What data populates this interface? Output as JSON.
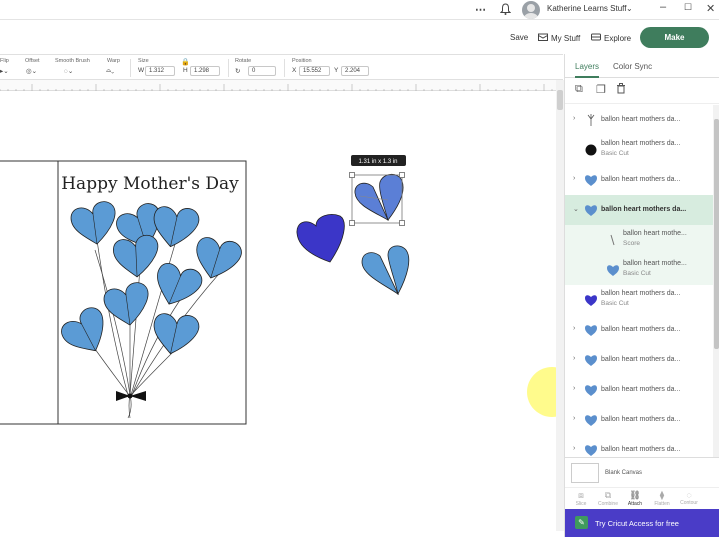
{
  "topbar": {
    "user_name": "Katherine Learns Stuff",
    "icons": [
      "more-icon",
      "bell-icon",
      "avatar",
      "chevron-down-icon",
      "minimize-icon",
      "maximize-icon",
      "close-icon"
    ]
  },
  "actions": {
    "save": "Save",
    "my_stuff": "My Stuff",
    "explore": "Explore",
    "make": "Make",
    "accent": "#3f7d5d"
  },
  "toolbar": {
    "flip_label": "Flip",
    "offset_label": "Offset",
    "smooth_label": "Smooth Brush",
    "warp_label": "Warp",
    "size_label": "Size",
    "w_prefix": "W",
    "w_value": "1.312",
    "h_prefix": "H",
    "h_value": "1.298",
    "rotate_label": "Rotate",
    "rotate_value": "0",
    "position_label": "Position",
    "x_prefix": "X",
    "x_value": "15.552",
    "y_prefix": "Y",
    "y_value": "2.204"
  },
  "canvas": {
    "card_title": "Happy Mother's Day",
    "size_tooltip": "1.31 in x 1.3 in"
  },
  "panel": {
    "tab_layers": "Layers",
    "tab_color_sync": "Color Sync",
    "layers": [
      {
        "name": "ballon heart mothers da...",
        "sub": "",
        "kind": "group",
        "thumb": "balloon"
      },
      {
        "name": "ballon heart mothers da...",
        "sub": "Basic Cut",
        "kind": "item",
        "thumb": "dot"
      },
      {
        "name": "ballon heart mothers da...",
        "sub": "",
        "kind": "group",
        "thumb": "heart-blue"
      },
      {
        "name": "ballon heart mothers da...",
        "sub": "",
        "kind": "selected",
        "thumb": "heart-blue"
      },
      {
        "name": "ballon heart mothe...",
        "sub": "Score",
        "kind": "child",
        "thumb": "line"
      },
      {
        "name": "ballon heart mothe...",
        "sub": "Basic Cut",
        "kind": "child",
        "thumb": "heart-blue"
      },
      {
        "name": "ballon heart mothers da...",
        "sub": "Basic Cut",
        "kind": "item",
        "thumb": "heart-purple"
      },
      {
        "name": "ballon heart mothers da...",
        "sub": "",
        "kind": "group",
        "thumb": "heart-blue"
      },
      {
        "name": "ballon heart mothers da...",
        "sub": "",
        "kind": "group",
        "thumb": "heart-blue"
      },
      {
        "name": "ballon heart mothers da...",
        "sub": "",
        "kind": "group",
        "thumb": "heart-blue"
      },
      {
        "name": "ballon heart mothers da...",
        "sub": "",
        "kind": "group",
        "thumb": "heart-blue"
      },
      {
        "name": "ballon heart mothers da...",
        "sub": "",
        "kind": "group",
        "thumb": "heart-blue"
      }
    ],
    "blank_canvas": "Blank Canvas",
    "bottom_tools": [
      "Slice",
      "Combine",
      "Attach",
      "Flatten",
      "Contour"
    ],
    "access_banner": "Try Cricut Access for free",
    "access_color": "#4a3cc7"
  }
}
